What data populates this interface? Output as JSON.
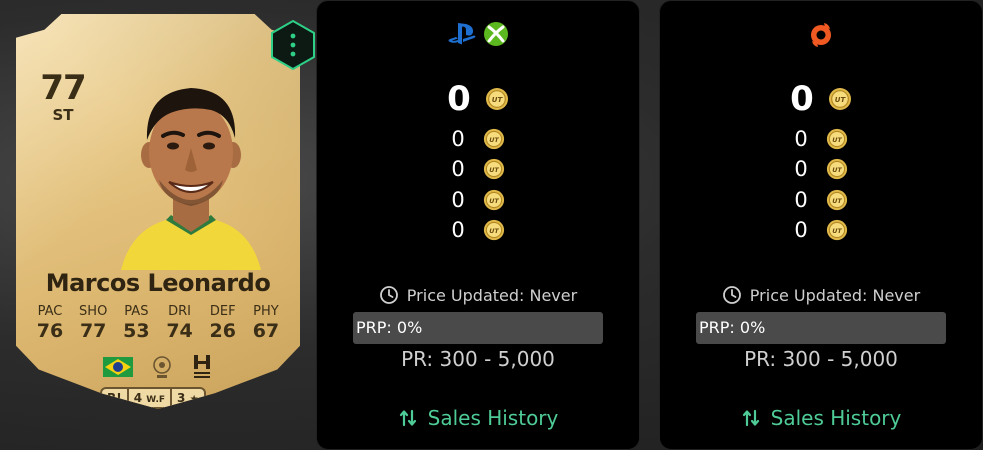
{
  "card": {
    "rating": "77",
    "position": "ST",
    "name": "Marcos Leonardo",
    "stats": [
      {
        "label": "PAC",
        "value": "76"
      },
      {
        "label": "SHO",
        "value": "77"
      },
      {
        "label": "PAS",
        "value": "53"
      },
      {
        "label": "DRI",
        "value": "74"
      },
      {
        "label": "DEF",
        "value": "26"
      },
      {
        "label": "PHY",
        "value": "67"
      }
    ],
    "pills": {
      "role": "R!",
      "weak_foot_value": "4",
      "weak_foot_label": "W.F",
      "skill_value": "3",
      "skill_icon": "★"
    },
    "icons": [
      "brazil-flag-icon",
      "league-logo-icon",
      "club-crest-icon"
    ]
  },
  "panels": [
    {
      "platform_icons": [
        "playstation-icon",
        "xbox-icon"
      ],
      "main_price": "0",
      "prices": [
        "0",
        "0",
        "0",
        "0"
      ],
      "updated": "Price Updated: Never",
      "prp": "PRP: 0%",
      "prp_value": 0,
      "range": "PR: 300 - 5,000",
      "sales": "Sales History"
    },
    {
      "platform_icons": [
        "origin-icon"
      ],
      "main_price": "0",
      "prices": [
        "0",
        "0",
        "0",
        "0"
      ],
      "updated": "Price Updated: Never",
      "prp": "PRP: 0%",
      "prp_value": 0,
      "range": "PR: 300 - 5,000",
      "sales": "Sales History"
    }
  ],
  "colors": {
    "accent_green": "#4ecb96",
    "card_gold": "#e6c684",
    "panel_bg": "#000000"
  }
}
